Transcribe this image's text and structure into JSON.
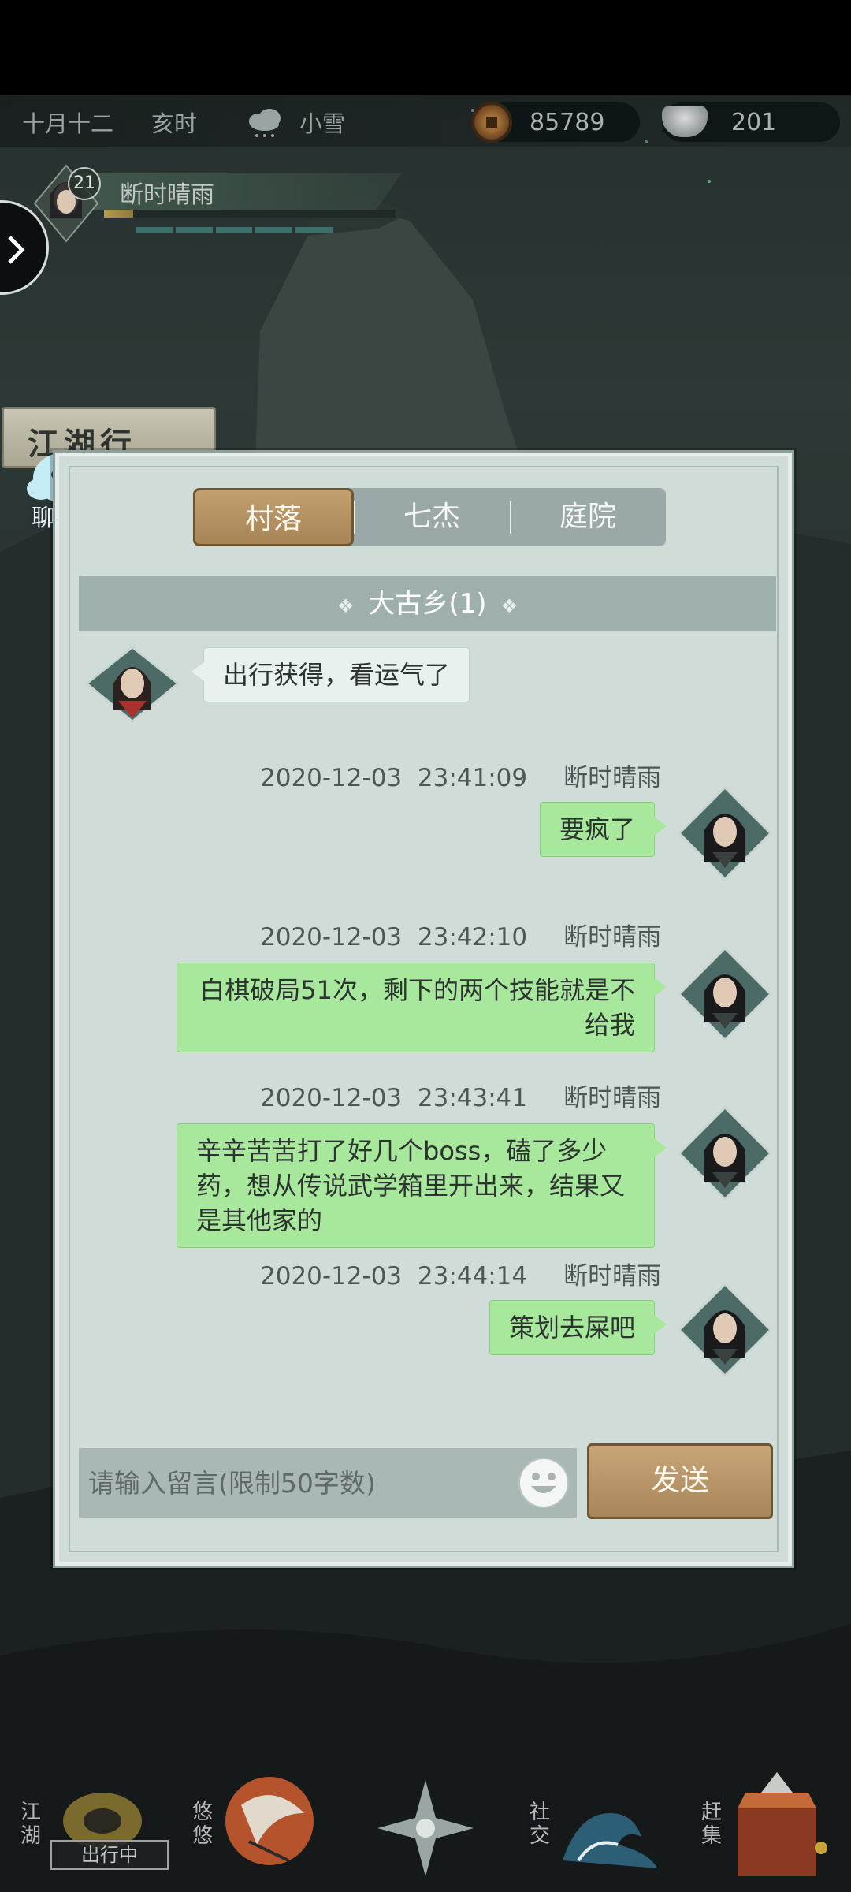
{
  "status_bar": {
    "date": "十月十二",
    "time": "亥时",
    "weather_icon": "cloud-snow-icon",
    "weather": "小雪",
    "copper_icon": "copper-coin-icon",
    "copper": "85789",
    "silver_icon": "silver-ingot-icon",
    "silver": "201"
  },
  "player": {
    "level": "21",
    "name": "断时晴雨",
    "hp_fraction": 0.1
  },
  "sign": {
    "title": "江湖行"
  },
  "chat_shortcut": {
    "label": "聊天"
  },
  "chat": {
    "tabs": [
      {
        "label": "村落",
        "active": true
      },
      {
        "label": "七杰",
        "active": false
      },
      {
        "label": "庭院",
        "active": false
      }
    ],
    "room": "大古乡(1)",
    "room_ornament": "❖",
    "messages": [
      {
        "from": "other",
        "text": "出行获得，看运气了"
      },
      {
        "from": "me",
        "date": "2020-12-03",
        "time": "23:41:09",
        "sender": "断时晴雨",
        "text": "要疯了"
      },
      {
        "from": "me",
        "date": "2020-12-03",
        "time": "23:42:10",
        "sender": "断时晴雨",
        "text": "白棋破局51次，剩下的两个技能就是不给我"
      },
      {
        "from": "me",
        "date": "2020-12-03",
        "time": "23:43:41",
        "sender": "断时晴雨",
        "text": "辛辛苦苦打了好几个boss，磕了多少药，想从传说武学箱里开出来，结果又是其他家的"
      },
      {
        "from": "me",
        "date": "2020-12-03",
        "time": "23:44:14",
        "sender": "断时晴雨",
        "text": "策划去屎吧"
      }
    ],
    "input_placeholder": "请输入留言(限制50字数)",
    "send_label": "发送"
  },
  "bottom_nav": {
    "items": [
      {
        "label": "江湖",
        "icon": "jianghu-icon"
      },
      {
        "label": "悠悠",
        "icon": "crane-icon"
      },
      {
        "label": "",
        "icon": "compass-star-icon"
      },
      {
        "label": "社交",
        "icon": "wave-icon"
      },
      {
        "label": "赶集",
        "icon": "market-basket-icon"
      }
    ],
    "outing_label": "出行中"
  },
  "colors": {
    "panel": "#cfdcd8",
    "my_bubble": "#a8e89c",
    "tab_active": "#b5925f"
  }
}
